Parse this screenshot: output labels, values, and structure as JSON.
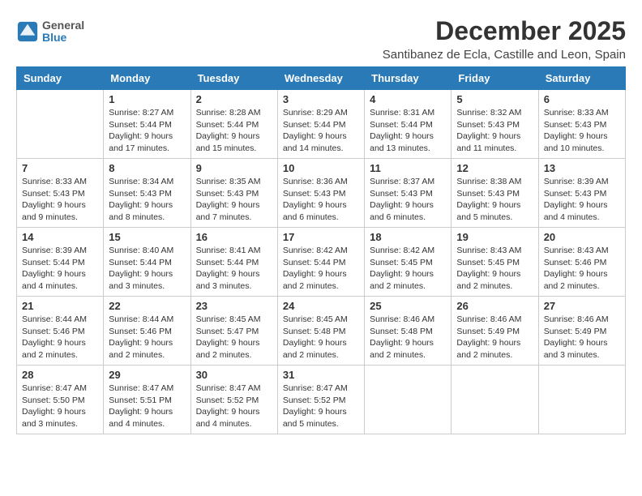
{
  "header": {
    "logo_top": "General",
    "logo_bottom": "Blue",
    "title": "December 2025",
    "subtitle": "Santibanez de Ecla, Castille and Leon, Spain"
  },
  "days_of_week": [
    "Sunday",
    "Monday",
    "Tuesday",
    "Wednesday",
    "Thursday",
    "Friday",
    "Saturday"
  ],
  "weeks": [
    [
      {
        "day": "",
        "info": ""
      },
      {
        "day": "1",
        "info": "Sunrise: 8:27 AM\nSunset: 5:44 PM\nDaylight: 9 hours\nand 17 minutes."
      },
      {
        "day": "2",
        "info": "Sunrise: 8:28 AM\nSunset: 5:44 PM\nDaylight: 9 hours\nand 15 minutes."
      },
      {
        "day": "3",
        "info": "Sunrise: 8:29 AM\nSunset: 5:44 PM\nDaylight: 9 hours\nand 14 minutes."
      },
      {
        "day": "4",
        "info": "Sunrise: 8:31 AM\nSunset: 5:44 PM\nDaylight: 9 hours\nand 13 minutes."
      },
      {
        "day": "5",
        "info": "Sunrise: 8:32 AM\nSunset: 5:43 PM\nDaylight: 9 hours\nand 11 minutes."
      },
      {
        "day": "6",
        "info": "Sunrise: 8:33 AM\nSunset: 5:43 PM\nDaylight: 9 hours\nand 10 minutes."
      }
    ],
    [
      {
        "day": "7",
        "info": "Sunrise: 8:33 AM\nSunset: 5:43 PM\nDaylight: 9 hours\nand 9 minutes."
      },
      {
        "day": "8",
        "info": "Sunrise: 8:34 AM\nSunset: 5:43 PM\nDaylight: 9 hours\nand 8 minutes."
      },
      {
        "day": "9",
        "info": "Sunrise: 8:35 AM\nSunset: 5:43 PM\nDaylight: 9 hours\nand 7 minutes."
      },
      {
        "day": "10",
        "info": "Sunrise: 8:36 AM\nSunset: 5:43 PM\nDaylight: 9 hours\nand 6 minutes."
      },
      {
        "day": "11",
        "info": "Sunrise: 8:37 AM\nSunset: 5:43 PM\nDaylight: 9 hours\nand 6 minutes."
      },
      {
        "day": "12",
        "info": "Sunrise: 8:38 AM\nSunset: 5:43 PM\nDaylight: 9 hours\nand 5 minutes."
      },
      {
        "day": "13",
        "info": "Sunrise: 8:39 AM\nSunset: 5:43 PM\nDaylight: 9 hours\nand 4 minutes."
      }
    ],
    [
      {
        "day": "14",
        "info": "Sunrise: 8:39 AM\nSunset: 5:44 PM\nDaylight: 9 hours\nand 4 minutes."
      },
      {
        "day": "15",
        "info": "Sunrise: 8:40 AM\nSunset: 5:44 PM\nDaylight: 9 hours\nand 3 minutes."
      },
      {
        "day": "16",
        "info": "Sunrise: 8:41 AM\nSunset: 5:44 PM\nDaylight: 9 hours\nand 3 minutes."
      },
      {
        "day": "17",
        "info": "Sunrise: 8:42 AM\nSunset: 5:44 PM\nDaylight: 9 hours\nand 2 minutes."
      },
      {
        "day": "18",
        "info": "Sunrise: 8:42 AM\nSunset: 5:45 PM\nDaylight: 9 hours\nand 2 minutes."
      },
      {
        "day": "19",
        "info": "Sunrise: 8:43 AM\nSunset: 5:45 PM\nDaylight: 9 hours\nand 2 minutes."
      },
      {
        "day": "20",
        "info": "Sunrise: 8:43 AM\nSunset: 5:46 PM\nDaylight: 9 hours\nand 2 minutes."
      }
    ],
    [
      {
        "day": "21",
        "info": "Sunrise: 8:44 AM\nSunset: 5:46 PM\nDaylight: 9 hours\nand 2 minutes."
      },
      {
        "day": "22",
        "info": "Sunrise: 8:44 AM\nSunset: 5:46 PM\nDaylight: 9 hours\nand 2 minutes."
      },
      {
        "day": "23",
        "info": "Sunrise: 8:45 AM\nSunset: 5:47 PM\nDaylight: 9 hours\nand 2 minutes."
      },
      {
        "day": "24",
        "info": "Sunrise: 8:45 AM\nSunset: 5:48 PM\nDaylight: 9 hours\nand 2 minutes."
      },
      {
        "day": "25",
        "info": "Sunrise: 8:46 AM\nSunset: 5:48 PM\nDaylight: 9 hours\nand 2 minutes."
      },
      {
        "day": "26",
        "info": "Sunrise: 8:46 AM\nSunset: 5:49 PM\nDaylight: 9 hours\nand 2 minutes."
      },
      {
        "day": "27",
        "info": "Sunrise: 8:46 AM\nSunset: 5:49 PM\nDaylight: 9 hours\nand 3 minutes."
      }
    ],
    [
      {
        "day": "28",
        "info": "Sunrise: 8:47 AM\nSunset: 5:50 PM\nDaylight: 9 hours\nand 3 minutes."
      },
      {
        "day": "29",
        "info": "Sunrise: 8:47 AM\nSunset: 5:51 PM\nDaylight: 9 hours\nand 4 minutes."
      },
      {
        "day": "30",
        "info": "Sunrise: 8:47 AM\nSunset: 5:52 PM\nDaylight: 9 hours\nand 4 minutes."
      },
      {
        "day": "31",
        "info": "Sunrise: 8:47 AM\nSunset: 5:52 PM\nDaylight: 9 hours\nand 5 minutes."
      },
      {
        "day": "",
        "info": ""
      },
      {
        "day": "",
        "info": ""
      },
      {
        "day": "",
        "info": ""
      }
    ]
  ]
}
